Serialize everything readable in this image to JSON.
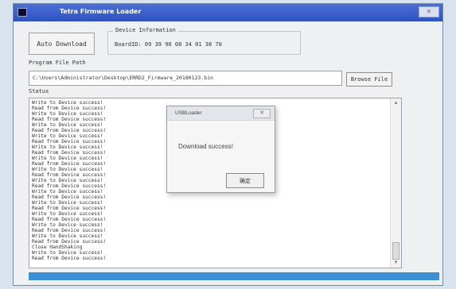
{
  "window": {
    "title": "Tetra Firmware Loader",
    "close_label": "✕"
  },
  "controls": {
    "auto_download_label": "Auto Download",
    "device_info_label": "Device Information",
    "device_info_value": "BoardID: 09 39 90 08 34 01 38 70",
    "program_path_label": "Program File Path",
    "program_path_value": "C:\\Users\\Administrator\\Desktop\\ERRD2_Firmware_20180123.bin",
    "browse_label": "Browse File",
    "status_label": "Status"
  },
  "status_log": [
    "Write to Device success!",
    "Read from Device success!",
    "Write to Device success!",
    "Read from Device success!",
    "Write to Device success!",
    "Read from Device success!",
    "Write to Device success!",
    "Read from Device success!",
    "Write to Device success!",
    "Read from Device success!",
    "Write to Device success!",
    "Read from Device success!",
    "Write to Device success!",
    "Read from Device success!",
    "Write to Device success!",
    "Read from Device success!",
    "Write to Device success!",
    "Read from Device success!",
    "Write to Device success!",
    "Read from Device success!",
    "Write to Device success!",
    "Read from Device success!",
    "Write to Device success!",
    "Read from Device success!",
    "Write to Device success!",
    "Read from Device success!",
    "Close HandShaking",
    "Write to Device success!",
    "Read from Device success!"
  ],
  "dialog": {
    "title": "USBLoader",
    "close_label": "✕",
    "message": "Download success!",
    "ok_label": "确定"
  },
  "progress": {
    "fraction": 1.0
  },
  "colors": {
    "titlebar": "#2f52c0",
    "progress": "#3d8fd3"
  }
}
